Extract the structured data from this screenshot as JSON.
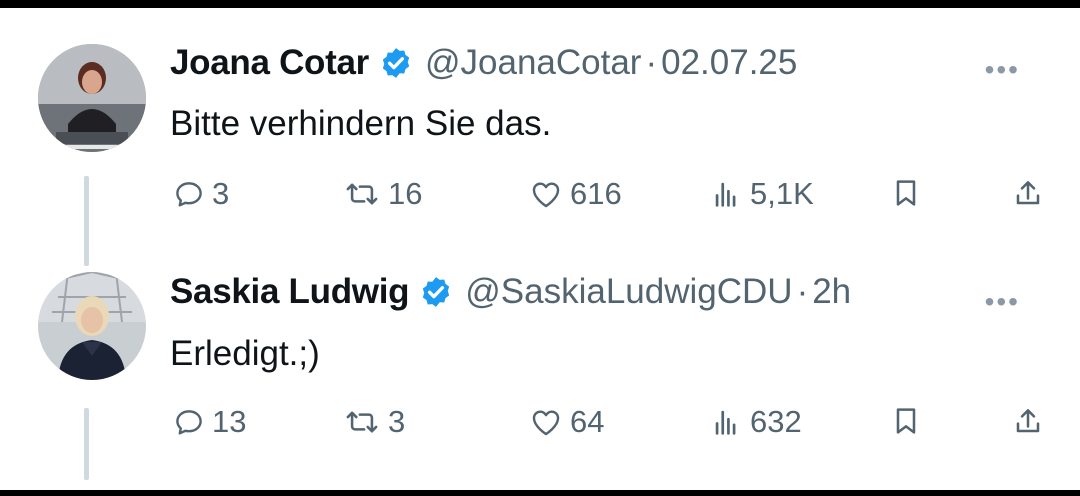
{
  "tweets": [
    {
      "name": "Joana Cotar",
      "handle": "@JoanaCotar",
      "separator": "·",
      "time": "02.07.25",
      "text": "Bitte verhindern Sie das.",
      "replies": "3",
      "reposts": "16",
      "likes": "616",
      "views": "5,1K",
      "more_label": "•••",
      "verified": true
    },
    {
      "name": "Saskia Ludwig",
      "handle": "@SaskiaLudwigCDU",
      "separator": "·",
      "time": "2h",
      "text": "Erledigt.;)",
      "replies": "13",
      "reposts": "3",
      "likes": "64",
      "views": "632",
      "more_label": "•••",
      "verified": true
    }
  ],
  "icons": {
    "reply": "reply-icon",
    "repost": "repost-icon",
    "like": "like-icon",
    "views": "views-icon",
    "bookmark": "bookmark-icon",
    "share": "share-icon",
    "verified": "verified-badge-icon"
  },
  "colors": {
    "icon_gray": "#536471",
    "verified_blue": "#1d9bf0",
    "thread_line": "#cfd9de"
  }
}
